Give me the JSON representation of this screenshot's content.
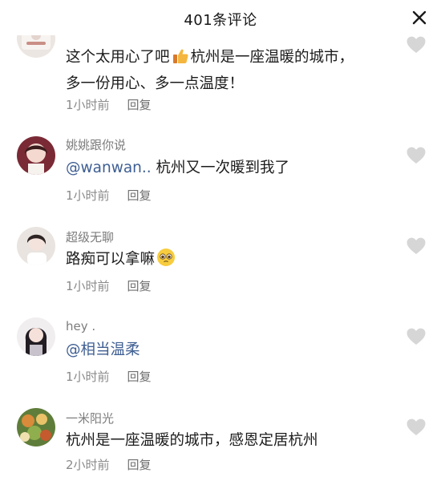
{
  "header": {
    "title": "401条评论"
  },
  "comments": [
    {
      "username": "",
      "text_a": "这个太用心了吧",
      "emoji": "thumbs-up",
      "text_b": "杭州是一座温暖的城市，",
      "text_c": "多一份用心、多一点温度！",
      "time": "1小时前",
      "reply": "回复"
    },
    {
      "username": "姚姚跟你说",
      "mention": "@wanwan..",
      "text": " 杭州又一次暖到我了",
      "time": "1小时前",
      "reply": "回复"
    },
    {
      "username": "超级无聊",
      "text": "路痴可以拿嘛",
      "emoji": "pleading-face",
      "time": "1小时前",
      "reply": "回复"
    },
    {
      "username": "hey .",
      "mention": "@相当温柔",
      "time": "1小时前",
      "reply": "回复"
    },
    {
      "username": "一米阳光",
      "text": "杭州是一座温暖的城市，感恩定居杭州",
      "time": "2小时前",
      "reply": "回复"
    }
  ],
  "icons": {
    "close": "close-icon",
    "like": "heart-outline-icon"
  },
  "colors": {
    "mention": "#3e5e92",
    "username": "#7c7c7c",
    "meta": "#8a8a8a",
    "heart": "#d6d6d6"
  }
}
